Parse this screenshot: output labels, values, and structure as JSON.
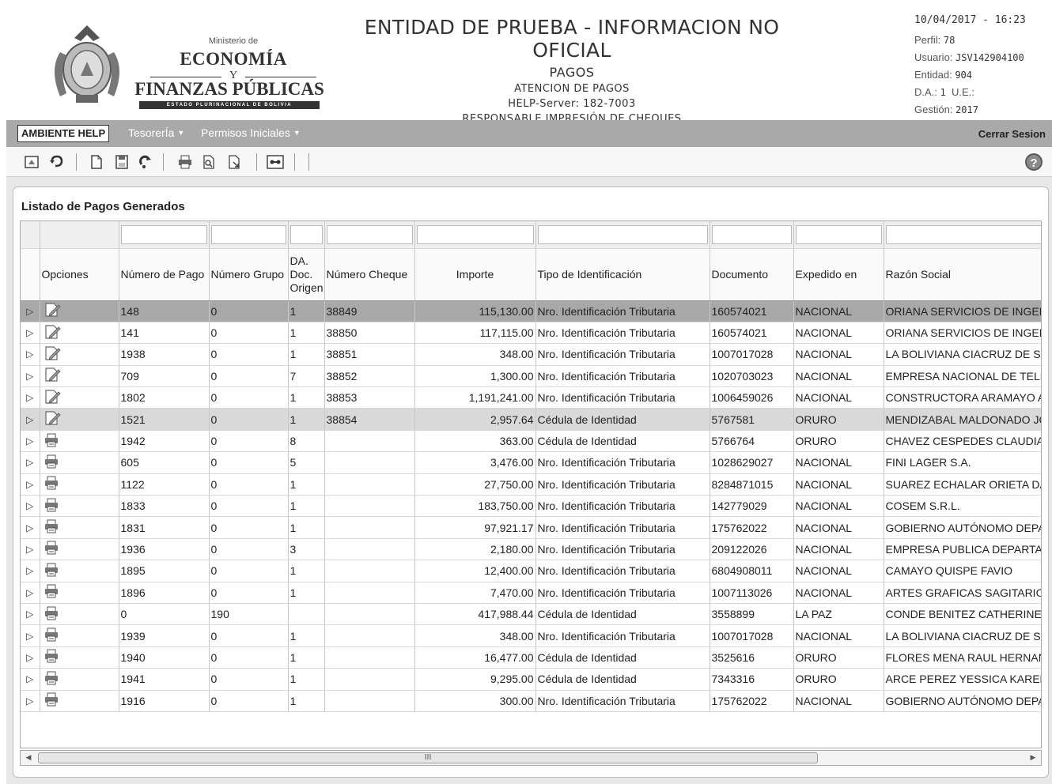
{
  "header": {
    "ministerio": "Ministerio de",
    "economia": "ECONOMÍA",
    "y": "Y",
    "finanzas": "FINANZAS PÚBLICAS",
    "estado": "ESTADO PLURINACIONAL DE BOLIVIA",
    "title": "ENTIDAD DE PRUEBA - INFORMACION NO OFICIAL",
    "subtitle": "PAGOS",
    "line3": "ATENCION DE PAGOS",
    "line4": "HELP-Server: 182-7003",
    "line5": "RESPONSABLE IMPRESIÓN DE CHEQUES",
    "datetime": "10/04/2017 - 16:23",
    "perfil_label": "Perfil:",
    "perfil": "78",
    "usuario_label": "Usuario:",
    "usuario": "JSV142904100",
    "entidad_label": "Entidad:",
    "entidad": "904",
    "da_label": "D.A.:",
    "da": "1",
    "ue_label": "U.E.:",
    "ue": "",
    "gestion_label": "Gestión:",
    "gestion": "2017"
  },
  "menubar": {
    "ambiente": "AMBIENTE HELP",
    "tesoreria": "TesorerÍa",
    "permisos": "Permisos Iniciales",
    "cerrar": "Cerrar Sesion"
  },
  "panel": {
    "title": "Listado de Pagos Generados"
  },
  "columns": {
    "opciones": "Opciones",
    "numero_pago": "Número de Pago",
    "numero_grupo": "Número Grupo",
    "da_doc_origen_1": "DA.",
    "da_doc_origen_2": "Doc.",
    "da_doc_origen_3": "Origen",
    "numero_cheque": "Número Cheque",
    "importe": "Importe",
    "tipo_identificacion": "Tipo de Identificación",
    "documento": "Documento",
    "expedido_en": "Expedido en",
    "razon_social": "Razón Social"
  },
  "rows": [
    {
      "icon": "edit",
      "pago": "148",
      "grupo": "0",
      "da": "1",
      "cheque": "38849",
      "importe": "115,130.00",
      "tipo": "Nro. Identificación Tributaria",
      "doc": "160574021",
      "exp": "NACIONAL",
      "razon": "ORIANA SERVICIOS DE INGENIE"
    },
    {
      "icon": "edit",
      "pago": "141",
      "grupo": "0",
      "da": "1",
      "cheque": "38850",
      "importe": "117,115.00",
      "tipo": "Nro. Identificación Tributaria",
      "doc": "160574021",
      "exp": "NACIONAL",
      "razon": "ORIANA SERVICIOS DE INGENIE"
    },
    {
      "icon": "edit",
      "pago": "1938",
      "grupo": "0",
      "da": "1",
      "cheque": "38851",
      "importe": "348.00",
      "tipo": "Nro. Identificación Tributaria",
      "doc": "1007017028",
      "exp": "NACIONAL",
      "razon": "LA BOLIVIANA CIACRUZ DE SEG"
    },
    {
      "icon": "edit",
      "pago": "709",
      "grupo": "0",
      "da": "7",
      "cheque": "38852",
      "importe": "1,300.00",
      "tipo": "Nro. Identificación Tributaria",
      "doc": "1020703023",
      "exp": "NACIONAL",
      "razon": "EMPRESA NACIONAL DE TELECO"
    },
    {
      "icon": "edit",
      "pago": "1802",
      "grupo": "0",
      "da": "1",
      "cheque": "38853",
      "importe": "1,191,241.00",
      "tipo": "Nro. Identificación Tributaria",
      "doc": "1006459026",
      "exp": "NACIONAL",
      "razon": "CONSTRUCTORA ARAMAYO AR"
    },
    {
      "icon": "edit",
      "pago": "1521",
      "grupo": "0",
      "da": "1",
      "cheque": "38854",
      "importe": "2,957.64",
      "tipo": "Cédula de Identidad",
      "doc": "5767581",
      "exp": "ORURO",
      "razon": "MENDIZABAL MALDONADO JOSE"
    },
    {
      "icon": "print",
      "pago": "1942",
      "grupo": "0",
      "da": "8",
      "cheque": "",
      "importe": "363.00",
      "tipo": "Cédula de Identidad",
      "doc": "5766764",
      "exp": "ORURO",
      "razon": "CHAVEZ CESPEDES CLAUDIA LU"
    },
    {
      "icon": "print",
      "pago": "605",
      "grupo": "0",
      "da": "5",
      "cheque": "",
      "importe": "3,476.00",
      "tipo": "Nro. Identificación Tributaria",
      "doc": "1028629027",
      "exp": "NACIONAL",
      "razon": "FINI LAGER S.A."
    },
    {
      "icon": "print",
      "pago": "1122",
      "grupo": "0",
      "da": "1",
      "cheque": "",
      "importe": "27,750.00",
      "tipo": "Nro. Identificación Tributaria",
      "doc": "8284871015",
      "exp": "NACIONAL",
      "razon": "SUAREZ ECHALAR ORIETA DAN"
    },
    {
      "icon": "print",
      "pago": "1833",
      "grupo": "0",
      "da": "1",
      "cheque": "",
      "importe": "183,750.00",
      "tipo": "Nro. Identificación Tributaria",
      "doc": "142779029",
      "exp": "NACIONAL",
      "razon": "COSEM S.R.L."
    },
    {
      "icon": "print",
      "pago": "1831",
      "grupo": "0",
      "da": "1",
      "cheque": "",
      "importe": "97,921.17",
      "tipo": "Nro. Identificación Tributaria",
      "doc": "175762022",
      "exp": "NACIONAL",
      "razon": "GOBIERNO AUTÓNOMO DEPART"
    },
    {
      "icon": "print",
      "pago": "1936",
      "grupo": "0",
      "da": "3",
      "cheque": "",
      "importe": "2,180.00",
      "tipo": "Nro. Identificación Tributaria",
      "doc": "209122026",
      "exp": "NACIONAL",
      "razon": "EMPRESA PUBLICA DEPARTAME"
    },
    {
      "icon": "print",
      "pago": "1895",
      "grupo": "0",
      "da": "1",
      "cheque": "",
      "importe": "12,400.00",
      "tipo": "Nro. Identificación Tributaria",
      "doc": "6804908011",
      "exp": "NACIONAL",
      "razon": "CAMAYO QUISPE FAVIO"
    },
    {
      "icon": "print",
      "pago": "1896",
      "grupo": "0",
      "da": "1",
      "cheque": "",
      "importe": "7,470.00",
      "tipo": "Nro. Identificación Tributaria",
      "doc": "1007113026",
      "exp": "NACIONAL",
      "razon": "ARTES GRAFICAS SAGITARIO S"
    },
    {
      "icon": "print",
      "pago": "0",
      "grupo": "190",
      "da": "",
      "cheque": "",
      "importe": "417,988.44",
      "tipo": "Cédula de Identidad",
      "doc": "3558899",
      "exp": "LA PAZ",
      "razon": "CONDE BENITEZ CATHERINE LIZ"
    },
    {
      "icon": "print",
      "pago": "1939",
      "grupo": "0",
      "da": "1",
      "cheque": "",
      "importe": "348.00",
      "tipo": "Nro. Identificación Tributaria",
      "doc": "1007017028",
      "exp": "NACIONAL",
      "razon": "LA BOLIVIANA CIACRUZ DE SEG"
    },
    {
      "icon": "print",
      "pago": "1940",
      "grupo": "0",
      "da": "1",
      "cheque": "",
      "importe": "16,477.00",
      "tipo": "Cédula de Identidad",
      "doc": "3525616",
      "exp": "ORURO",
      "razon": "FLORES MENA RAUL HERNAN"
    },
    {
      "icon": "print",
      "pago": "1941",
      "grupo": "0",
      "da": "1",
      "cheque": "",
      "importe": "9,295.00",
      "tipo": "Cédula de Identidad",
      "doc": "7343316",
      "exp": "ORURO",
      "razon": "ARCE PEREZ YESSICA KAREN"
    },
    {
      "icon": "print",
      "pago": "1916",
      "grupo": "0",
      "da": "1",
      "cheque": "",
      "importe": "300.00",
      "tipo": "Nro. Identificación Tributaria",
      "doc": "175762022",
      "exp": "NACIONAL",
      "razon": "GOBIERNO AUTÓNOMO DEPART"
    }
  ],
  "scrollbar": {
    "thumb_label": "III"
  }
}
